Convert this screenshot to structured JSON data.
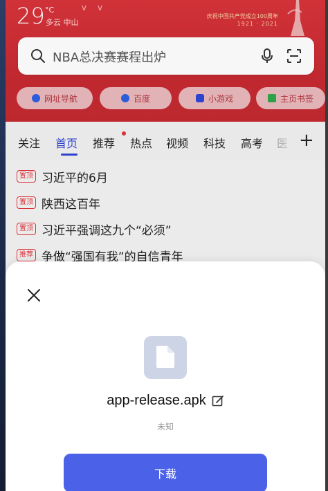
{
  "header": {
    "temperature": "29",
    "degree_unit": "°C",
    "weather_text": "多云 中山",
    "banner_line1": "庆祝中国共产党成立100周年",
    "banner_line2": "1921 · 2021"
  },
  "search": {
    "placeholder": "NBA总决赛赛程出炉",
    "icons": [
      "search-icon",
      "microphone-icon",
      "scan-icon"
    ]
  },
  "quick_links": [
    {
      "label": "网址导航",
      "icon": "compass-icon",
      "color": "#2e5fe0"
    },
    {
      "label": "百度",
      "icon": "paw-icon",
      "color": "#2e5fe0"
    },
    {
      "label": "小游戏",
      "icon": "gamepad-icon",
      "color": "#2e46d4"
    },
    {
      "label": "主页书签",
      "icon": "bookmark-icon",
      "color": "#2fa84a"
    }
  ],
  "tabs": [
    {
      "label": "关注"
    },
    {
      "label": "首页",
      "active": true
    },
    {
      "label": "推荐"
    },
    {
      "label": "热点"
    },
    {
      "label": "视频"
    },
    {
      "label": "科技"
    },
    {
      "label": "高考"
    },
    {
      "label": "医"
    }
  ],
  "news": [
    {
      "tag": "置顶",
      "title": "习近平的6月"
    },
    {
      "tag": "置顶",
      "title": "陕西这百年"
    },
    {
      "tag": "置顶",
      "title": "习近平强调这九个“必须”"
    },
    {
      "tag": "推荐",
      "title": "争做“强国有我”的自信青年"
    }
  ],
  "dialog": {
    "filename": "app-release.apk",
    "size_text": "未知",
    "download_label": "下载"
  },
  "colors": {
    "header_red": "#d02f37",
    "accent_blue": "#4a61e8",
    "tab_active": "#2e46d4"
  }
}
